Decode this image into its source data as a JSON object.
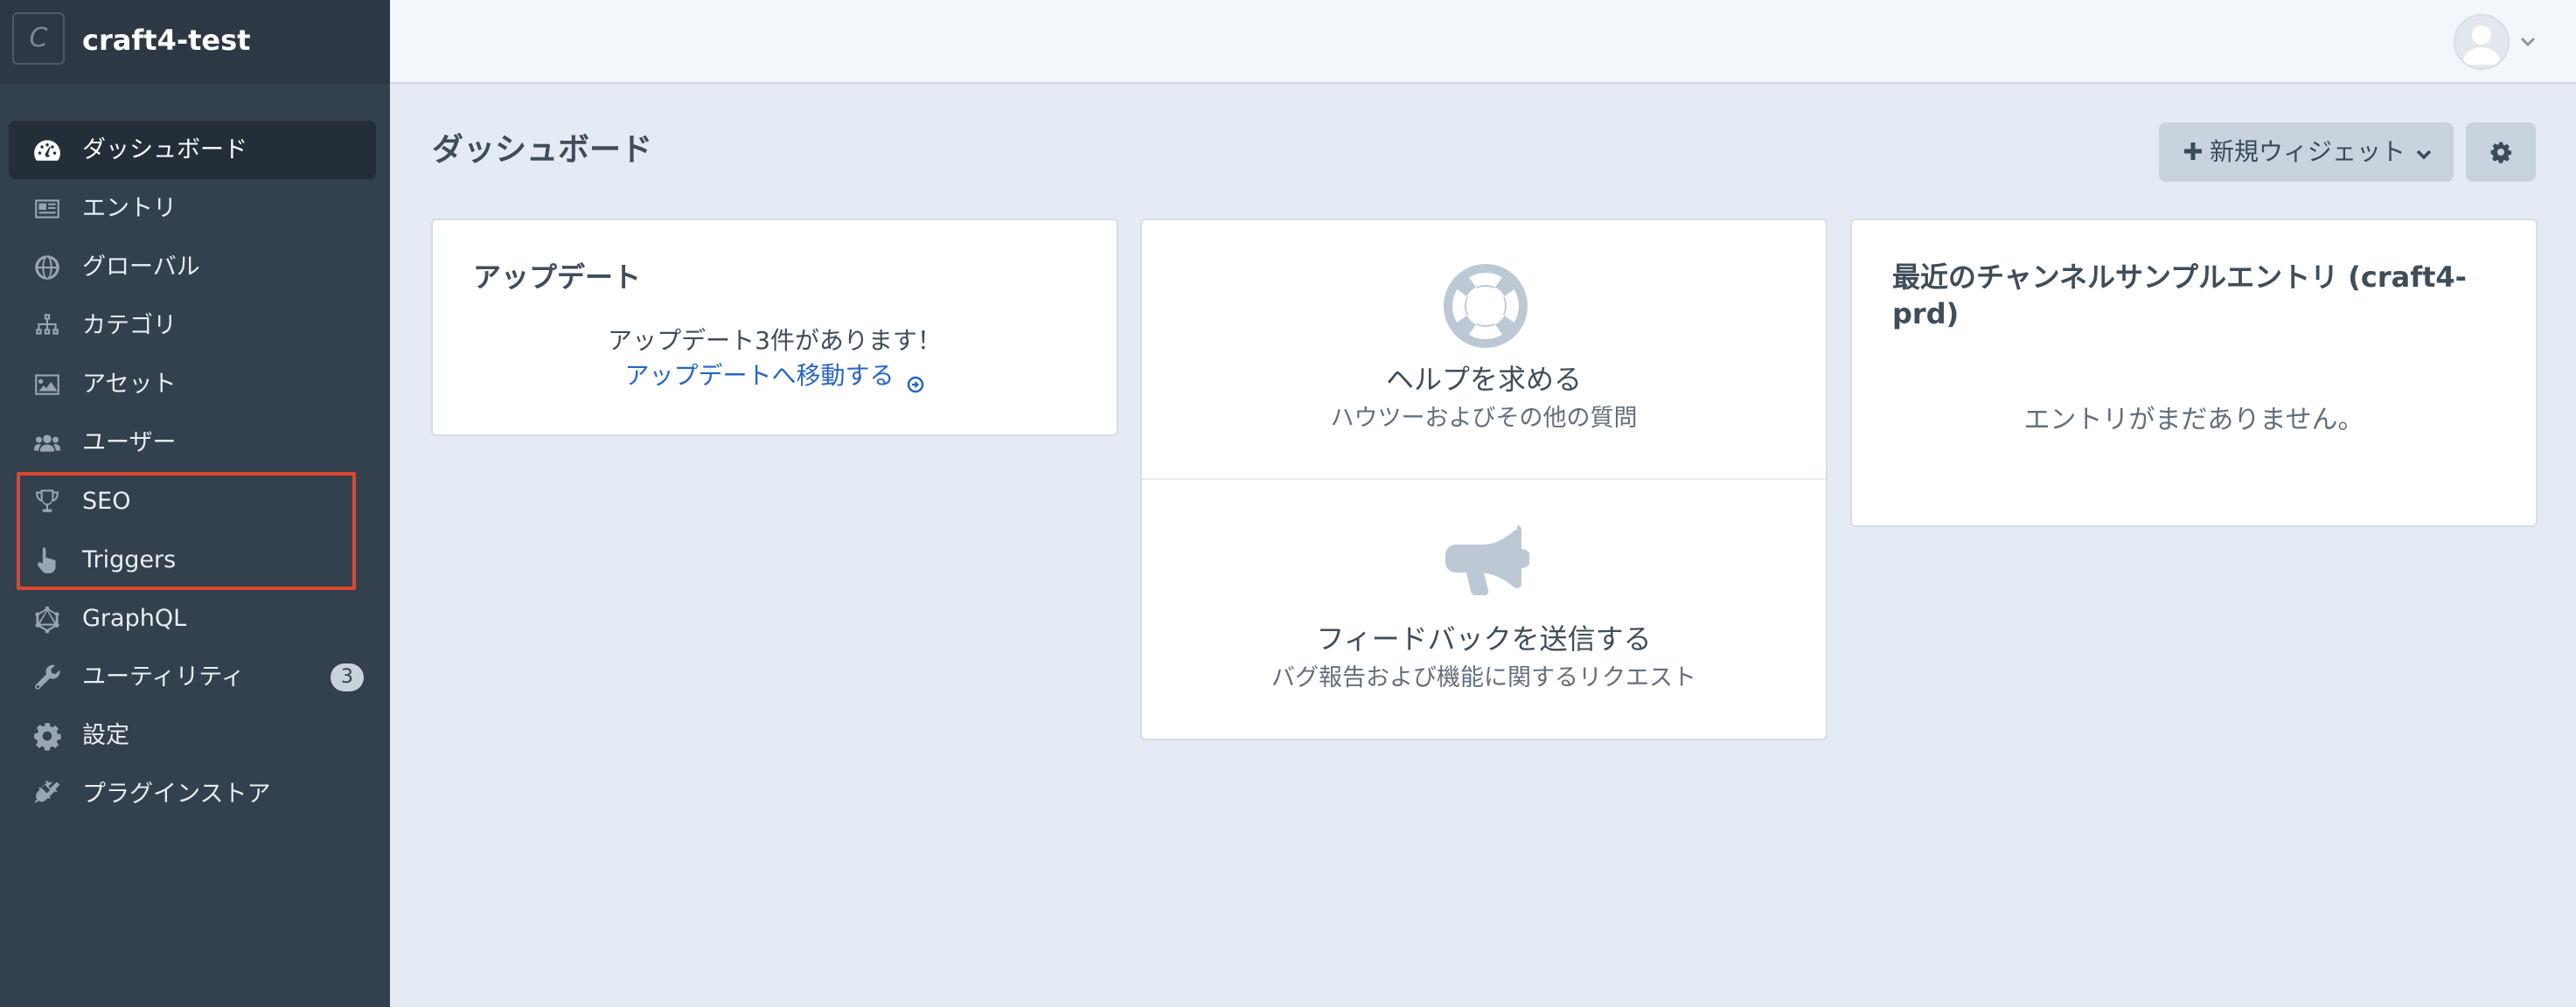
{
  "site": {
    "name": "craft4-test",
    "logo_letter": "C"
  },
  "sidebar": {
    "items": [
      {
        "label": "ダッシュボード",
        "icon": "gauge-icon",
        "active": true
      },
      {
        "label": "エントリ",
        "icon": "newspaper-icon"
      },
      {
        "label": "グローバル",
        "icon": "globe-icon"
      },
      {
        "label": "カテゴリ",
        "icon": "sitemap-icon"
      },
      {
        "label": "アセット",
        "icon": "image-icon"
      },
      {
        "label": "ユーザー",
        "icon": "users-icon"
      },
      {
        "label": "SEO",
        "icon": "trophy-icon"
      },
      {
        "label": "Triggers",
        "icon": "pointing-hand-icon"
      },
      {
        "label": "GraphQL",
        "icon": "graphql-icon"
      },
      {
        "label": "ユーティリティ",
        "icon": "wrench-icon",
        "badge": "3"
      },
      {
        "label": "設定",
        "icon": "gear-icon"
      },
      {
        "label": "プラグインストア",
        "icon": "plug-icon"
      }
    ]
  },
  "header": {
    "title": "ダッシュボード"
  },
  "toolbar": {
    "new_widget_label": "新規ウィジェット"
  },
  "widgets": {
    "updates": {
      "title": "アップデート",
      "message": "アップデート3件があります！",
      "link": "アップデートへ移動する"
    },
    "help": {
      "help_title": "ヘルプを求める",
      "help_sub": "ハウツーおよびその他の質問",
      "feedback_title": "フィードバックを送信する",
      "feedback_sub": "バグ報告および機能に関するリクエスト"
    },
    "recent": {
      "title": "最近のチャンネルサンプルエントリ (craft4-prd)",
      "empty": "エントリがまだありません。"
    }
  },
  "colors": {
    "sidebar_bg": "#33404d",
    "main_bg": "#e4ebf4",
    "link": "#2765c4",
    "highlight": "#e0462f"
  }
}
